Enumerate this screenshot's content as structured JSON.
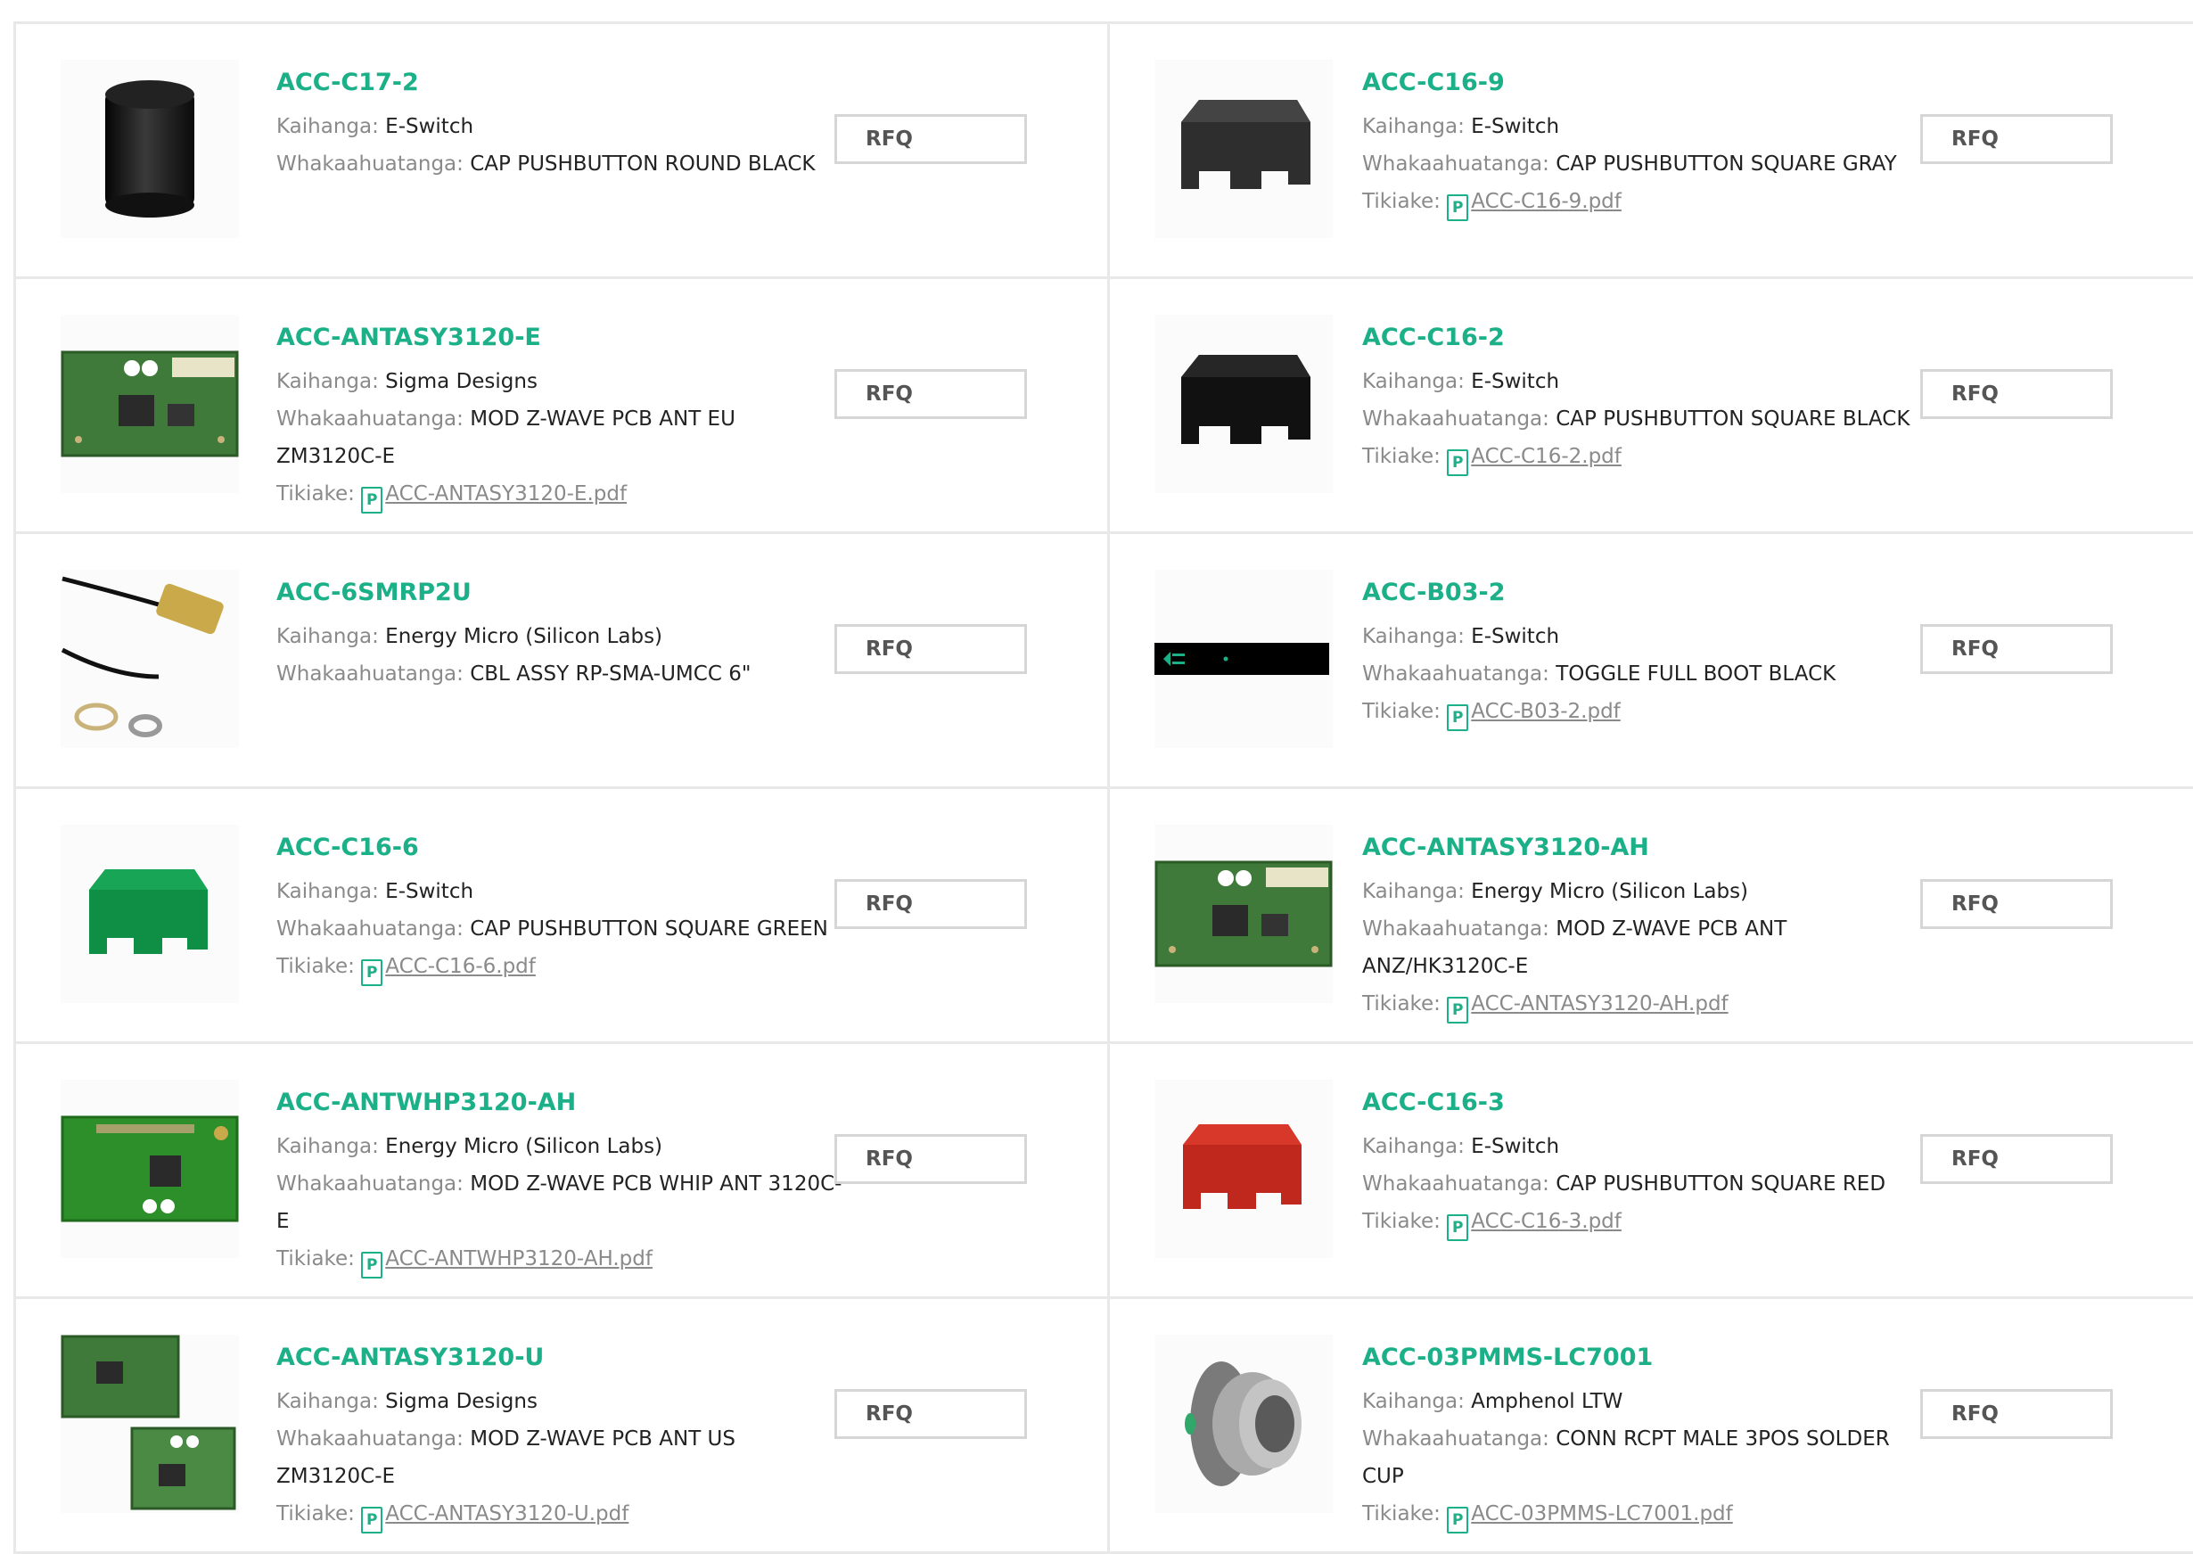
{
  "labels": {
    "manufacturer": "Kaihanga: ",
    "description": "Whakaahuatanga: ",
    "datasheet": "Tikiake: ",
    "rfq": "RFQ",
    "pdf_glyph": "P"
  },
  "colors": {
    "accent": "#1bb088",
    "border": "#e8e8e8",
    "label": "#8a8a8a"
  },
  "products": [
    {
      "part": "ACC-C17-2",
      "manufacturer": "E-Switch",
      "description": "CAP PUSHBUTTON ROUND BLACK",
      "datasheet": "",
      "image": "round-black-cap-image"
    },
    {
      "part": "ACC-C16-9",
      "manufacturer": "E-Switch",
      "description": "CAP PUSHBUTTON SQUARE GRAY",
      "datasheet": "ACC-C16-9.pdf",
      "image": "square-gray-cap-image"
    },
    {
      "part": "ACC-ANTASY3120-E",
      "manufacturer": "Sigma Designs",
      "description": "MOD Z-WAVE PCB ANT EU ZM3120C-E",
      "datasheet": "ACC-ANTASY3120-E.pdf",
      "image": "pcb-module-image"
    },
    {
      "part": "ACC-C16-2",
      "manufacturer": "E-Switch",
      "description": "CAP PUSHBUTTON SQUARE BLACK",
      "datasheet": "ACC-C16-2.pdf",
      "image": "square-black-cap-image"
    },
    {
      "part": "ACC-6SMRP2U",
      "manufacturer": "Energy Micro (Silicon Labs)",
      "description": "CBL ASSY RP-SMA-UMCC 6\"",
      "datasheet": "",
      "image": "cable-assembly-image"
    },
    {
      "part": "ACC-B03-2",
      "manufacturer": "E-Switch",
      "description": "TOGGLE FULL BOOT BLACK",
      "datasheet": "ACC-B03-2.pdf",
      "image": "toggle-boot-image"
    },
    {
      "part": "ACC-C16-6",
      "manufacturer": "E-Switch",
      "description": "CAP PUSHBUTTON SQUARE GREEN",
      "datasheet": "ACC-C16-6.pdf",
      "image": "square-green-cap-image"
    },
    {
      "part": "ACC-ANTASY3120-AH",
      "manufacturer": "Energy Micro (Silicon Labs)",
      "description": "MOD Z-WAVE PCB ANT ANZ/HK3120C-E",
      "datasheet": "ACC-ANTASY3120-AH.pdf",
      "image": "pcb-module-image"
    },
    {
      "part": "ACC-ANTWHP3120-AH",
      "manufacturer": "Energy Micro (Silicon Labs)",
      "description": "MOD Z-WAVE PCB WHIP ANT 3120C-E",
      "datasheet": "ACC-ANTWHP3120-AH.pdf",
      "image": "pcb-whip-module-image"
    },
    {
      "part": "ACC-C16-3",
      "manufacturer": "E-Switch",
      "description": "CAP PUSHBUTTON SQUARE RED",
      "datasheet": "ACC-C16-3.pdf",
      "image": "square-red-cap-image"
    },
    {
      "part": "ACC-ANTASY3120-U",
      "manufacturer": "Sigma Designs",
      "description": "MOD Z-WAVE PCB ANT US ZM3120C-E",
      "datasheet": "ACC-ANTASY3120-U.pdf",
      "image": "dual-pcb-module-image"
    },
    {
      "part": "ACC-03PMMS-LC7001",
      "manufacturer": "Amphenol LTW",
      "description": "CONN RCPT MALE 3POS SOLDER CUP",
      "datasheet": "ACC-03PMMS-LC7001.pdf",
      "image": "circular-connector-image"
    }
  ]
}
